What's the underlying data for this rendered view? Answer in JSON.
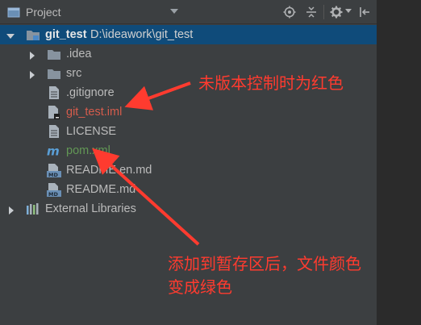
{
  "header": {
    "title": "Project"
  },
  "tree": {
    "root": {
      "name": "git_test",
      "path": "D:\\ideawork\\git_test"
    },
    "items": [
      {
        "label": ".idea"
      },
      {
        "label": "src"
      },
      {
        "label": ".gitignore"
      },
      {
        "label": "git_test.iml"
      },
      {
        "label": "LICENSE"
      },
      {
        "label": "pom.xml"
      },
      {
        "label": "README.en.md"
      },
      {
        "label": "README.md"
      }
    ],
    "external": {
      "label": "External Libraries"
    }
  },
  "annotations": {
    "note1": "未版本控制时为红色",
    "note2_line1": "添加到暂存区后，文件颜色",
    "note2_line2": "变成绿色"
  },
  "colors": {
    "panel_bg": "#3c3f41",
    "selected_row": "#0f4b7a",
    "untracked": "#d65c4c",
    "added": "#629755",
    "annotation": "#ff3b2f"
  }
}
